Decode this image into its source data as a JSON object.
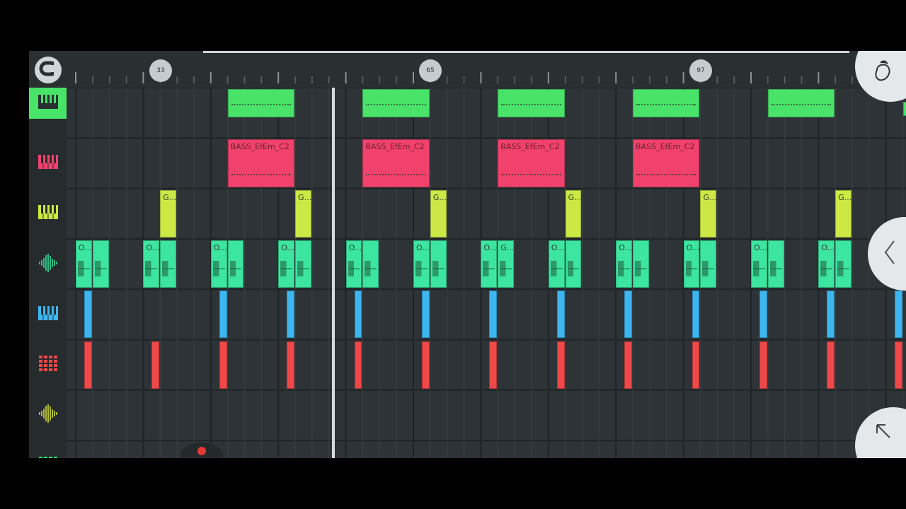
{
  "timeline": {
    "markers": [
      "33",
      "65",
      "97"
    ]
  },
  "tracks": [
    {
      "name": "green-piano",
      "color": "#49e36a",
      "icon": "piano-icon"
    },
    {
      "name": "bass-piano",
      "color": "#f0426c",
      "icon": "piano-icon"
    },
    {
      "name": "yellow-piano",
      "color": "#cde845",
      "icon": "piano-icon"
    },
    {
      "name": "audio-green",
      "color": "#3de6a0",
      "icon": "waveform-icon"
    },
    {
      "name": "blue-piano",
      "color": "#3db6f0",
      "icon": "piano-icon"
    },
    {
      "name": "red-drums",
      "color": "#ef4848",
      "icon": "drum-grid-icon"
    },
    {
      "name": "audio-yellow",
      "color": "#d8e93a",
      "icon": "waveform-icon"
    },
    {
      "name": "green-drums",
      "color": "#33e061",
      "icon": "drum-grid-icon"
    }
  ],
  "clips": {
    "bass_label": "BASS_EfEm_C2",
    "yellow_label": "G...",
    "audio_label": "O...",
    "audio_label_alt": "G..."
  },
  "colors": {
    "background": "#2d3336",
    "sidebar": "#262b2e",
    "ruler": "#2a2f32",
    "green": "#49e36a",
    "pink": "#f0426c",
    "yellow": "#cde845",
    "mint": "#3de6a0",
    "blue": "#3db6f0",
    "red": "#ef4848"
  }
}
